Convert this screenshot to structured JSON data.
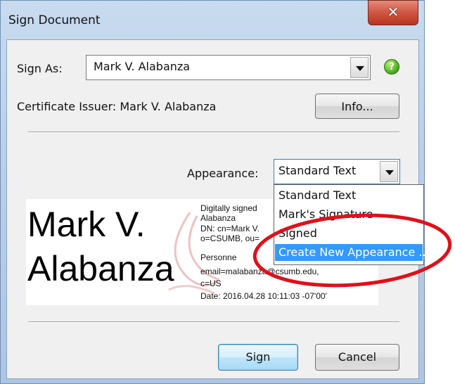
{
  "window": {
    "title": "Sign Document",
    "close_icon": "close-icon"
  },
  "sign_as": {
    "label": "Sign As:",
    "value": "Mark V. Alabanza",
    "help_icon": "help-icon"
  },
  "certificate": {
    "label": "Certificate Issuer: Mark V. Alabanza",
    "info_button": "Info..."
  },
  "appearance": {
    "label": "Appearance:",
    "value": "Standard Text",
    "options": [
      "Standard Text",
      "Mark's Signature",
      "Signed",
      "Create New Appearance ..."
    ],
    "selected_option": "Create New Appearance ..."
  },
  "signature_preview": {
    "name_line1": "Mark V.",
    "name_line2": "Alabanza",
    "details": [
      "Digitally signed",
      "Alabanza",
      "DN: cn=Mark V.",
      "o=CSUMB, ou=",
      "Personne",
      "email=malabanza@csumb.edu,",
      "c=US",
      "Date: 2016.04.28 10:11:03 -07'00'"
    ]
  },
  "buttons": {
    "sign": "Sign",
    "cancel": "Cancel"
  },
  "colors": {
    "selection": "#3399ff",
    "annotation": "#e0101a",
    "accent_icon": "#5cb82a"
  }
}
